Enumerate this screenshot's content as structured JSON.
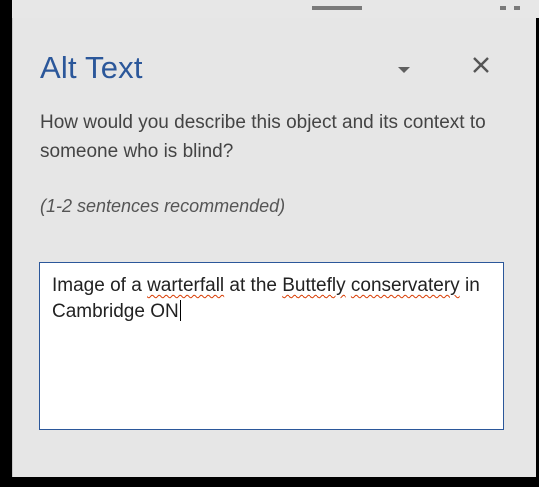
{
  "pane": {
    "title": "Alt Text",
    "question": "How would you describe this object and its context to someone who is blind?",
    "hint": "(1-2 sentences recommended)",
    "description": {
      "segments": [
        {
          "text": "Image of a ",
          "misspelled": false
        },
        {
          "text": "warterfall",
          "misspelled": true
        },
        {
          "text": " at the ",
          "misspelled": false
        },
        {
          "text": "Buttefly",
          "misspelled": true
        },
        {
          "text": " ",
          "misspelled": false
        },
        {
          "text": "conservatery",
          "misspelled": true
        },
        {
          "text": " in Cambridge ON",
          "misspelled": false
        }
      ]
    },
    "icons": {
      "options": "chevron-down-icon",
      "close": "close-icon"
    }
  },
  "colors": {
    "title": "#2b579a",
    "panel_background": "#e6e6e6",
    "textbox_border": "#2b579a",
    "spellcheck_underline": "#d83b01",
    "frame": "#000000"
  }
}
